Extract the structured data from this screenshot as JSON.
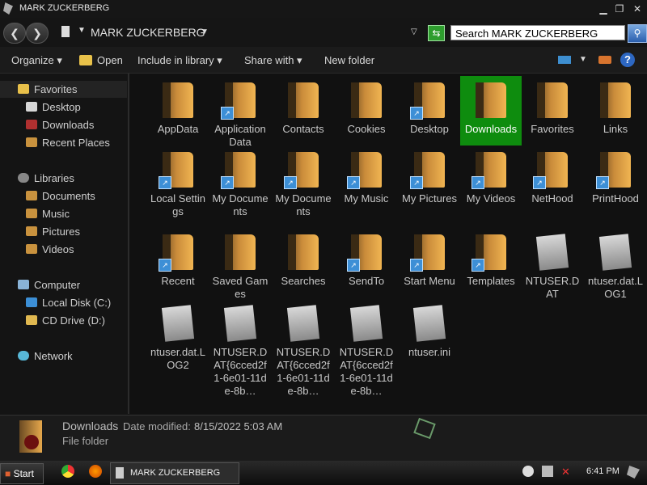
{
  "window": {
    "title": "MARK ZUCKERBERG"
  },
  "address": {
    "path": "MARK ZUCKERBERG",
    "search_placeholder": "Search MARK ZUCKERBERG"
  },
  "toolbar": {
    "organize": "Organize",
    "open": "Open",
    "include": "Include in library",
    "share": "Share with",
    "newfolder": "New folder"
  },
  "sidebar": {
    "favorites": "Favorites",
    "fav_items": [
      "Desktop",
      "Downloads",
      "Recent Places"
    ],
    "libraries": "Libraries",
    "lib_items": [
      "Documents",
      "Music",
      "Pictures",
      "Videos"
    ],
    "computer": "Computer",
    "comp_items": [
      "Local Disk (C:)",
      "CD Drive (D:)"
    ],
    "network": "Network"
  },
  "items": [
    "AppData",
    "Application Data",
    "Contacts",
    "Cookies",
    "Desktop",
    "Downloads",
    "Favorites",
    "Links",
    "Local Settings",
    "My Documents",
    "My Documents",
    "My Music",
    "My Pictures",
    "My Videos",
    "NetHood",
    "PrintHood",
    "Recent",
    "Saved Games",
    "Searches",
    "SendTo",
    "Start Menu",
    "Templates",
    "NTUSER.DAT",
    "ntuser.dat.LOG1",
    "ntuser.dat.LOG2",
    "NTUSER.DAT{6cced2f1-6e01-11de-8b…",
    "NTUSER.DAT{6cced2f1-6e01-11de-8b…",
    "NTUSER.DAT{6cced2f1-6e01-11de-8b…",
    "ntuser.ini"
  ],
  "details": {
    "name": "Downloads",
    "date_label": "Date modified:",
    "date": "8/15/2022 5:03 AM",
    "type": "File folder"
  },
  "taskbar": {
    "start": "Start",
    "task": "MARK ZUCKERBERG",
    "clock": "6:41 PM"
  },
  "colors": {
    "selection": "#0e8c0e",
    "background": "#111111"
  }
}
